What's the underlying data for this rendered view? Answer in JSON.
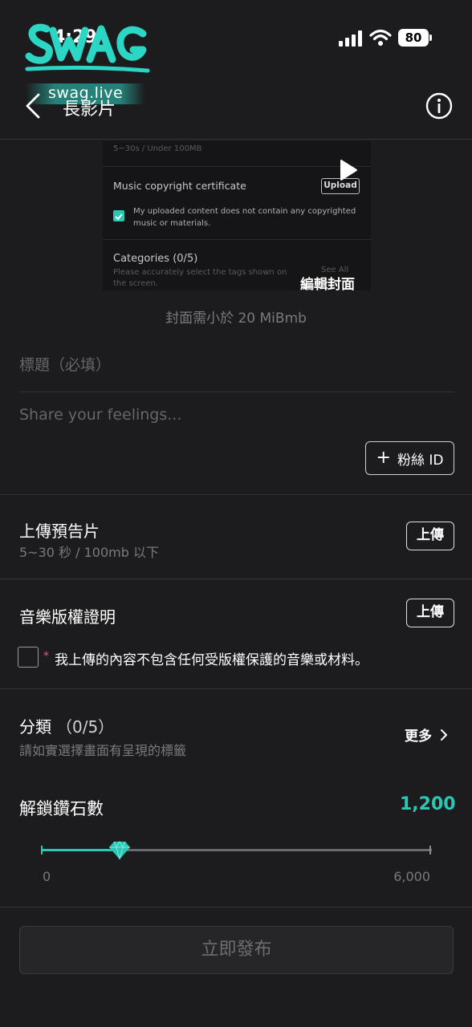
{
  "status_bar": {
    "time": "4:29",
    "battery": "80",
    "signal_icon": "cellular-signal-icon",
    "wifi_icon": "wifi-icon"
  },
  "watermark": {
    "logo_text": "SWAG",
    "site": "swag.live"
  },
  "header": {
    "title": "長影片",
    "back_icon": "chevron-left-icon",
    "info_icon": "info-circle-icon"
  },
  "cover_preview": {
    "top_text": "5~30s / Under 100MB",
    "music_label": "Music copyright certificate",
    "upload_label": "Upload",
    "checkbox_text": "My uploaded content does not contain any copyrighted music or materials.",
    "categories_label": "Categories",
    "categories_count": "(0/5)",
    "categories_hint": "Please accurately select the tags shown on the screen.",
    "see_all": "See All",
    "edit_cover_label": "編輯封面"
  },
  "cover_hint": "封面需小於 20 MiBmb",
  "form": {
    "title_placeholder": "標題（必填）",
    "desc_placeholder": "Share your feelings...",
    "fan_id_button": "粉絲 ID"
  },
  "trailer": {
    "title": "上傳預告片",
    "subtitle": "5~30 秒 / 100mb 以下",
    "button": "上傳"
  },
  "music_cert": {
    "title": "音樂版權證明",
    "button": "上傳",
    "required_mark": "*",
    "checkbox_text": "我上傳的內容不包含任何受版權保護的音樂或材料。"
  },
  "category": {
    "title": "分類",
    "count": "（0/5）",
    "subtitle": "請如實選擇畫面有呈現的標籤",
    "more_label": "更多"
  },
  "unlock": {
    "title": "解鎖鑽石數",
    "value": "1,200",
    "value_number": 1200,
    "min_label": "0",
    "max_label": "6,000",
    "min": 0,
    "max": 6000,
    "accent_color": "#2cc7b4"
  },
  "publish_button": "立即發布"
}
